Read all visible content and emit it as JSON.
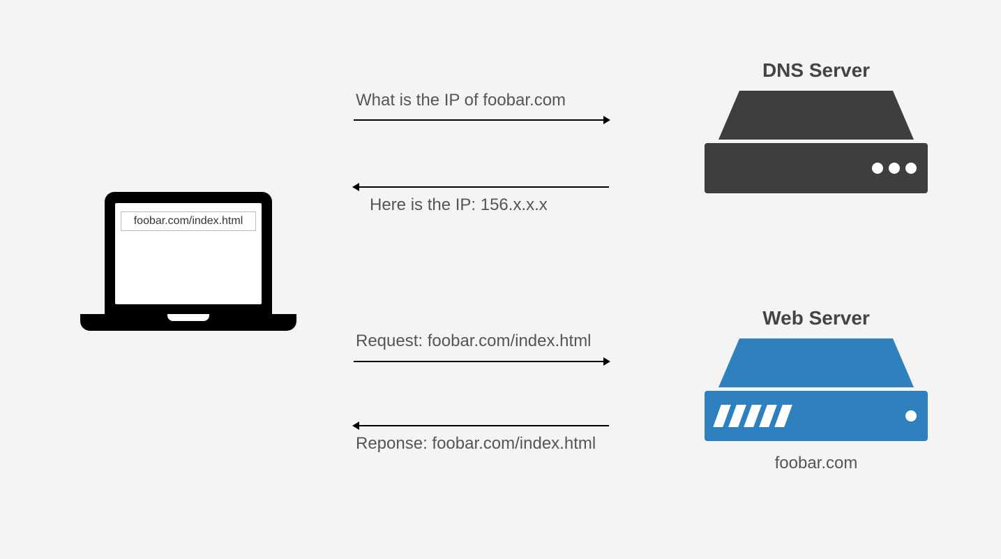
{
  "client": {
    "url_text": "foobar.com/index.html"
  },
  "dns": {
    "title": "DNS Server",
    "query": "What is the IP of foobar.com",
    "reply": "Here is the IP: 156.x.x.x"
  },
  "web": {
    "title": "Web Server",
    "request": "Request: foobar.com/index.html",
    "response": "Reponse: foobar.com/index.html",
    "caption": "foobar.com"
  }
}
